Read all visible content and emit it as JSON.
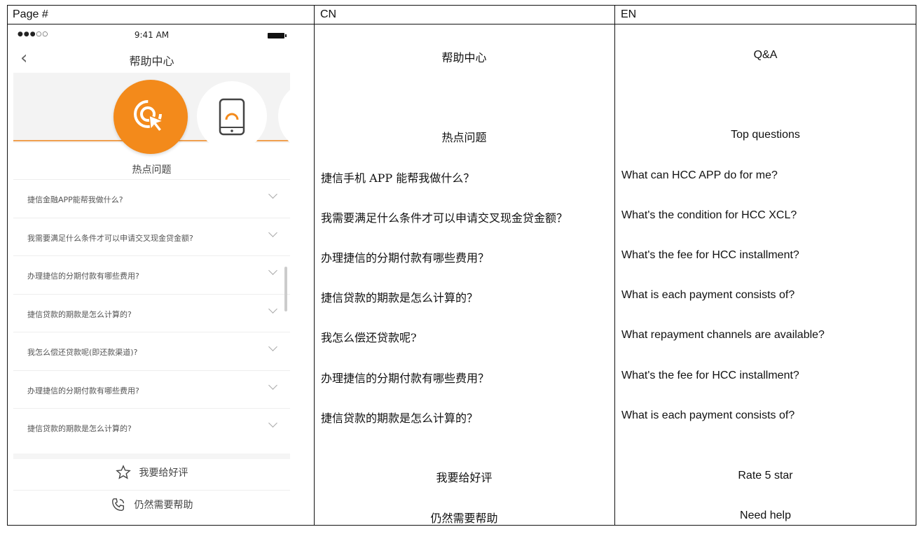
{
  "headers": {
    "page": "Page #",
    "cn": "CN",
    "en": "EN"
  },
  "phone": {
    "status_time": "9:41 AM",
    "status_signal": "●●●○○",
    "nav_title": "帮助中心",
    "section_title": "热点问题",
    "faq": [
      "捷信金融APP能帮我做什么?",
      "我需要满足什么条件才可以申请交叉现金贷金额?",
      "办理捷信的分期付款有哪些费用?",
      "捷信贷款的期款是怎么计算的?",
      "我怎么偿还贷款呢(即还款渠道)?",
      "办理捷信的分期付款有哪些费用?",
      "捷信贷款的期款是怎么计算的?"
    ],
    "rate_label": "我要给好评",
    "help_label": "仍然需要帮助",
    "icons": [
      "back-chevron-icon",
      "tap-icon",
      "phone-gauge-icon",
      "star-icon",
      "phone-call-icon",
      "chevron-down-icon"
    ],
    "accent_color": "#f38a1b"
  },
  "cn": {
    "title": "帮助中心",
    "section": "热点问题",
    "questions": [
      "捷信手机 APP 能帮我做什么？",
      "我需要满足什么条件才可以申请交叉现金贷金额？",
      "办理捷信的分期付款有哪些费用？",
      "捷信贷款的期款是怎么计算的？",
      "我怎么偿还贷款呢?",
      "办理捷信的分期付款有哪些费用？",
      "捷信贷款的期款是怎么计算的？"
    ],
    "rate": "我要给好评",
    "help": "仍然需要帮助"
  },
  "en": {
    "title": "Q&A",
    "section": "Top questions",
    "questions": [
      "What can HCC APP do for me?",
      "What's the condition for HCC XCL?",
      "What's the fee for HCC installment?",
      "What is each payment consists of?",
      "What repayment channels are available?",
      "What's the fee for HCC installment?",
      "What is each payment consists of?"
    ],
    "rate": "Rate 5 star",
    "help": "Need help"
  }
}
